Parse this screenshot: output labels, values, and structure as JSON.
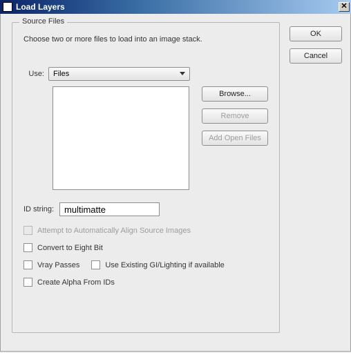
{
  "window": {
    "title": "Load Layers",
    "close_label": "✕"
  },
  "buttons": {
    "ok": "OK",
    "cancel": "Cancel",
    "browse": "Browse...",
    "remove": "Remove",
    "add_open": "Add Open Files"
  },
  "group": {
    "legend": "Source Files",
    "description": "Choose two or more files to load into an image stack."
  },
  "use": {
    "label": "Use:",
    "selected": "Files"
  },
  "id_string": {
    "label": "ID string:",
    "value": "multimatte"
  },
  "options": {
    "auto_align": "Attempt to Automatically Align Source Images",
    "eight_bit": "Convert to Eight Bit",
    "vray_passes": "Vray Passes",
    "use_existing_gi": "Use Existing GI/Lighting if available",
    "create_alpha": "Create Alpha From IDs"
  }
}
